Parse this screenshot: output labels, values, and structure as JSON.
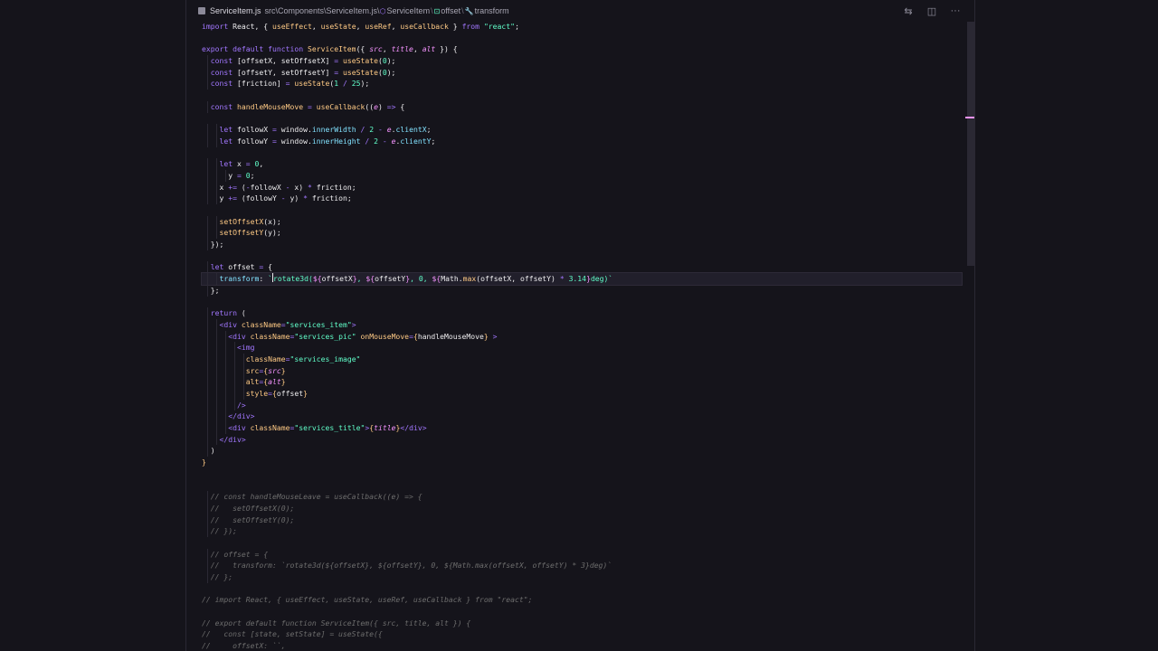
{
  "breadcrumb": {
    "file": "ServiceItem.js",
    "path": "src\\Components\\ServiceItem.js\\",
    "sym1": "ServiceItem",
    "sym2": "offset",
    "sym3": "transform",
    "sep": "\\"
  },
  "actions": {
    "compare_glyph": "⇆",
    "split_glyph": "◫",
    "more_glyph": "···"
  },
  "colors": {
    "background": "#15141b",
    "keyword": "#a277ff",
    "function": "#ffca85",
    "string": "#61ffca",
    "parameter": "#f694ff",
    "property": "#82e2ff",
    "comment": "#6d6d6d"
  },
  "code_lines": [
    [
      [
        "kw",
        "import "
      ],
      [
        "txt",
        "React, { "
      ],
      [
        "fn",
        "useEffect"
      ],
      [
        "txt",
        ", "
      ],
      [
        "fn",
        "useState"
      ],
      [
        "txt",
        ", "
      ],
      [
        "fn",
        "useRef"
      ],
      [
        "txt",
        ", "
      ],
      [
        "fn",
        "useCallback"
      ],
      [
        "txt",
        " } "
      ],
      [
        "kw",
        "from "
      ],
      [
        "str",
        "\"react\""
      ],
      [
        "txt",
        ";"
      ]
    ],
    [],
    [
      [
        "kw",
        "export default function "
      ],
      [
        "fn",
        "ServiceItem"
      ],
      [
        "txt",
        "({ "
      ],
      [
        "param",
        "src"
      ],
      [
        "txt",
        ", "
      ],
      [
        "param",
        "title"
      ],
      [
        "txt",
        ", "
      ],
      [
        "param",
        "alt"
      ],
      [
        "txt",
        " }) {"
      ]
    ],
    [
      [
        "txt",
        "  "
      ],
      [
        "kw",
        "const "
      ],
      [
        "txt",
        "[offsetX, setOffsetX] "
      ],
      [
        "op",
        "= "
      ],
      [
        "fn",
        "useState"
      ],
      [
        "txt",
        "("
      ],
      [
        "num",
        "0"
      ],
      [
        "txt",
        ");"
      ]
    ],
    [
      [
        "txt",
        "  "
      ],
      [
        "kw",
        "const "
      ],
      [
        "txt",
        "[offsetY, setOffsetY] "
      ],
      [
        "op",
        "= "
      ],
      [
        "fn",
        "useState"
      ],
      [
        "txt",
        "("
      ],
      [
        "num",
        "0"
      ],
      [
        "txt",
        ");"
      ]
    ],
    [
      [
        "txt",
        "  "
      ],
      [
        "kw",
        "const "
      ],
      [
        "txt",
        "[friction] "
      ],
      [
        "op",
        "= "
      ],
      [
        "fn",
        "useState"
      ],
      [
        "txt",
        "("
      ],
      [
        "num",
        "1"
      ],
      [
        "op",
        " / "
      ],
      [
        "num",
        "25"
      ],
      [
        "txt",
        ");"
      ]
    ],
    [],
    [
      [
        "txt",
        "  "
      ],
      [
        "kw",
        "const "
      ],
      [
        "fn",
        "handleMouseMove "
      ],
      [
        "op",
        "= "
      ],
      [
        "fn",
        "useCallback"
      ],
      [
        "txt",
        "(("
      ],
      [
        "param",
        "e"
      ],
      [
        "txt",
        ") "
      ],
      [
        "kw",
        "=> "
      ],
      [
        "txt",
        "{"
      ]
    ],
    [],
    [
      [
        "txt",
        "    "
      ],
      [
        "kw",
        "let "
      ],
      [
        "txt",
        "followX "
      ],
      [
        "op",
        "= "
      ],
      [
        "txt",
        "window."
      ],
      [
        "prop",
        "innerWidth "
      ],
      [
        "op",
        "/ "
      ],
      [
        "num",
        "2 "
      ],
      [
        "op",
        "- "
      ],
      [
        "param",
        "e"
      ],
      [
        "txt",
        "."
      ],
      [
        "prop",
        "clientX"
      ],
      [
        "txt",
        ";"
      ]
    ],
    [
      [
        "txt",
        "    "
      ],
      [
        "kw",
        "let "
      ],
      [
        "txt",
        "followY "
      ],
      [
        "op",
        "= "
      ],
      [
        "txt",
        "window."
      ],
      [
        "prop",
        "innerHeight "
      ],
      [
        "op",
        "/ "
      ],
      [
        "num",
        "2 "
      ],
      [
        "op",
        "- "
      ],
      [
        "param",
        "e"
      ],
      [
        "txt",
        "."
      ],
      [
        "prop",
        "clientY"
      ],
      [
        "txt",
        ";"
      ]
    ],
    [],
    [
      [
        "txt",
        "    "
      ],
      [
        "kw",
        "let "
      ],
      [
        "txt",
        "x "
      ],
      [
        "op",
        "= "
      ],
      [
        "num",
        "0"
      ],
      [
        "txt",
        ","
      ]
    ],
    [
      [
        "txt",
        "      y "
      ],
      [
        "op",
        "= "
      ],
      [
        "num",
        "0"
      ],
      [
        "txt",
        ";"
      ]
    ],
    [
      [
        "txt",
        "    x "
      ],
      [
        "op",
        "+= "
      ],
      [
        "txt",
        "("
      ],
      [
        "op",
        "-"
      ],
      [
        "txt",
        "followX "
      ],
      [
        "op",
        "- "
      ],
      [
        "txt",
        "x) "
      ],
      [
        "op",
        "* "
      ],
      [
        "txt",
        "friction;"
      ]
    ],
    [
      [
        "txt",
        "    y "
      ],
      [
        "op",
        "+= "
      ],
      [
        "txt",
        "(followY "
      ],
      [
        "op",
        "- "
      ],
      [
        "txt",
        "y) "
      ],
      [
        "op",
        "* "
      ],
      [
        "txt",
        "friction;"
      ]
    ],
    [],
    [
      [
        "txt",
        "    "
      ],
      [
        "fn",
        "setOffsetX"
      ],
      [
        "txt",
        "(x);"
      ]
    ],
    [
      [
        "txt",
        "    "
      ],
      [
        "fn",
        "setOffsetY"
      ],
      [
        "txt",
        "(y);"
      ]
    ],
    [
      [
        "txt",
        "  });"
      ]
    ],
    [],
    [
      [
        "txt",
        "  "
      ],
      [
        "kw",
        "let "
      ],
      [
        "txt",
        "offset "
      ],
      [
        "op",
        "= "
      ],
      [
        "txt",
        "{"
      ]
    ],
    [
      [
        "txt",
        "    "
      ],
      [
        "prop",
        "transform"
      ],
      [
        "txt",
        ": "
      ],
      [
        "tpl",
        "`"
      ],
      [
        "cursor",
        ""
      ],
      [
        "tpl",
        "rotate3d("
      ],
      [
        "tplx",
        "${"
      ],
      [
        "txt",
        "offsetX"
      ],
      [
        "tplx",
        "}"
      ],
      [
        "tpl",
        ", "
      ],
      [
        "tplx",
        "${"
      ],
      [
        "txt",
        "offsetY"
      ],
      [
        "tplx",
        "}"
      ],
      [
        "tpl",
        ", 0, "
      ],
      [
        "tplx",
        "${"
      ],
      [
        "txt",
        "Math."
      ],
      [
        "fn",
        "max"
      ],
      [
        "txt",
        "(offsetX, offsetY) "
      ],
      [
        "op",
        "* "
      ],
      [
        "num",
        "3.14"
      ],
      [
        "tplx",
        "}"
      ],
      [
        "tpl",
        "deg)`"
      ]
    ],
    [
      [
        "txt",
        "  };"
      ]
    ],
    [],
    [
      [
        "txt",
        "  "
      ],
      [
        "kw",
        "return "
      ],
      [
        "txt",
        "("
      ]
    ],
    [
      [
        "txt",
        "    "
      ],
      [
        "tag",
        "<div "
      ],
      [
        "attr",
        "className"
      ],
      [
        "op",
        "="
      ],
      [
        "str",
        "\"services_item\""
      ],
      [
        "tag",
        ">"
      ]
    ],
    [
      [
        "txt",
        "      "
      ],
      [
        "tag",
        "<div "
      ],
      [
        "attr",
        "className"
      ],
      [
        "op",
        "="
      ],
      [
        "str",
        "\"services_pic\" "
      ],
      [
        "attr",
        "onMouseMove"
      ],
      [
        "op",
        "="
      ],
      [
        "brace",
        "{"
      ],
      [
        "txt",
        "handleMouseMove"
      ],
      [
        "brace",
        "}"
      ],
      [
        "tag",
        " >"
      ]
    ],
    [
      [
        "txt",
        "        "
      ],
      [
        "tag",
        "<img"
      ]
    ],
    [
      [
        "txt",
        "          "
      ],
      [
        "attr",
        "className"
      ],
      [
        "op",
        "="
      ],
      [
        "str",
        "\"services_image\""
      ]
    ],
    [
      [
        "txt",
        "          "
      ],
      [
        "attr",
        "src"
      ],
      [
        "op",
        "="
      ],
      [
        "brace",
        "{"
      ],
      [
        "param",
        "src"
      ],
      [
        "brace",
        "}"
      ]
    ],
    [
      [
        "txt",
        "          "
      ],
      [
        "attr",
        "alt"
      ],
      [
        "op",
        "="
      ],
      [
        "brace",
        "{"
      ],
      [
        "param",
        "alt"
      ],
      [
        "brace",
        "}"
      ]
    ],
    [
      [
        "txt",
        "          "
      ],
      [
        "attr",
        "style"
      ],
      [
        "op",
        "="
      ],
      [
        "brace",
        "{"
      ],
      [
        "txt",
        "offset"
      ],
      [
        "brace",
        "}"
      ]
    ],
    [
      [
        "txt",
        "        "
      ],
      [
        "tag",
        "/>"
      ]
    ],
    [
      [
        "txt",
        "      "
      ],
      [
        "tag",
        "</div>"
      ]
    ],
    [
      [
        "txt",
        "      "
      ],
      [
        "tag",
        "<div "
      ],
      [
        "attr",
        "className"
      ],
      [
        "op",
        "="
      ],
      [
        "str",
        "\"services_title\""
      ],
      [
        "tag",
        ">"
      ],
      [
        "brace",
        "{"
      ],
      [
        "param",
        "title"
      ],
      [
        "brace",
        "}"
      ],
      [
        "tag",
        "</div>"
      ]
    ],
    [
      [
        "txt",
        "    "
      ],
      [
        "tag",
        "</div>"
      ]
    ],
    [
      [
        "txt",
        "  )"
      ]
    ],
    [
      [
        "brace",
        "}"
      ]
    ],
    [],
    [],
    [
      [
        "txt",
        "  "
      ],
      [
        "cm",
        "// const handleMouseLeave = useCallback((e) => {"
      ]
    ],
    [
      [
        "txt",
        "  "
      ],
      [
        "cm",
        "//   setOffsetX(0);"
      ]
    ],
    [
      [
        "txt",
        "  "
      ],
      [
        "cm",
        "//   setOffsetY(0);"
      ]
    ],
    [
      [
        "txt",
        "  "
      ],
      [
        "cm",
        "// });"
      ]
    ],
    [],
    [
      [
        "txt",
        "  "
      ],
      [
        "cm",
        "// offset = {"
      ]
    ],
    [
      [
        "txt",
        "  "
      ],
      [
        "cm",
        "//   transform: `rotate3d(${offsetX}, ${offsetY}, 0, ${Math.max(offsetX, offsetY) * 3}deg)`"
      ]
    ],
    [
      [
        "txt",
        "  "
      ],
      [
        "cm",
        "// };"
      ]
    ],
    [],
    [
      [
        "cm",
        "// import React, { useEffect, useState, useRef, useCallback } from \"react\";"
      ]
    ],
    [],
    [
      [
        "cm",
        "// export default function ServiceItem({ src, title, alt }) {"
      ]
    ],
    [
      [
        "cm",
        "//   const [state, setState] = useState({"
      ]
    ],
    [
      [
        "cm",
        "//     offsetX: ``,"
      ]
    ]
  ]
}
